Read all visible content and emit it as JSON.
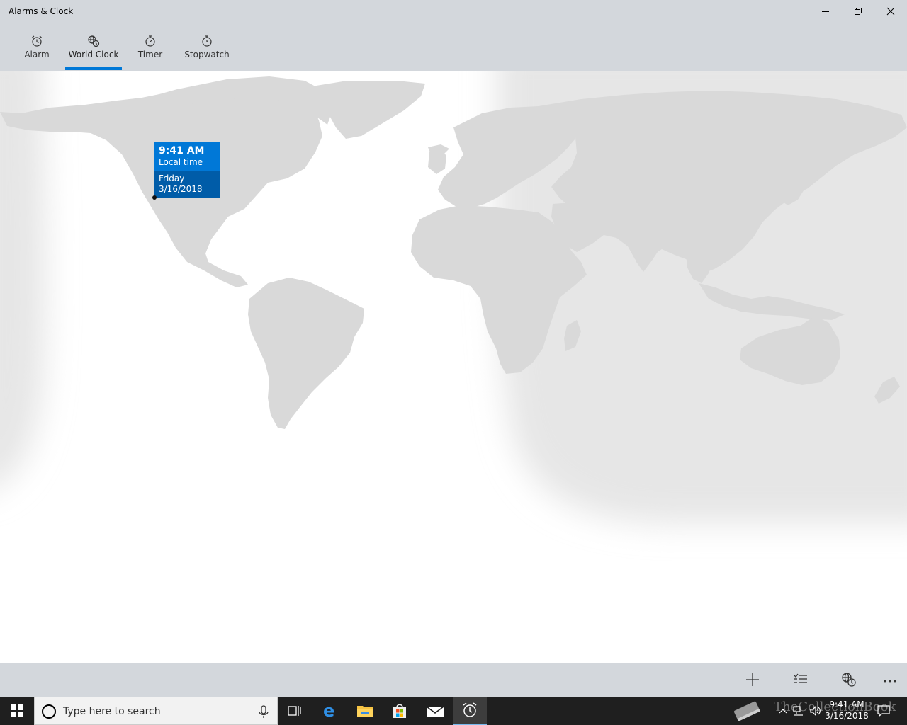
{
  "window": {
    "title": "Alarms & Clock"
  },
  "tabs": [
    {
      "label": "Alarm",
      "icon": "alarm-clock-icon"
    },
    {
      "label": "World Clock",
      "icon": "world-clock-icon",
      "active": true
    },
    {
      "label": "Timer",
      "icon": "timer-icon"
    },
    {
      "label": "Stopwatch",
      "icon": "stopwatch-icon"
    }
  ],
  "callout": {
    "time": "9:41 AM",
    "label": "Local time",
    "day": "Friday",
    "date": "3/16/2018"
  },
  "commands": [
    {
      "icon": "add-icon"
    },
    {
      "icon": "select-list-icon"
    },
    {
      "icon": "compare-clock-icon"
    },
    {
      "icon": "more-icon"
    }
  ],
  "taskbar": {
    "search_placeholder": "Type here to search",
    "clock_time": "9:41 AM",
    "clock_date": "3/16/2018",
    "watermark": "TheCollectionBook"
  },
  "colors": {
    "accent": "#0078d7",
    "accent_dark": "#005ca8",
    "chrome": "#d3d7dc",
    "night": "#e6e6e6",
    "land": "#d9d9d9"
  }
}
